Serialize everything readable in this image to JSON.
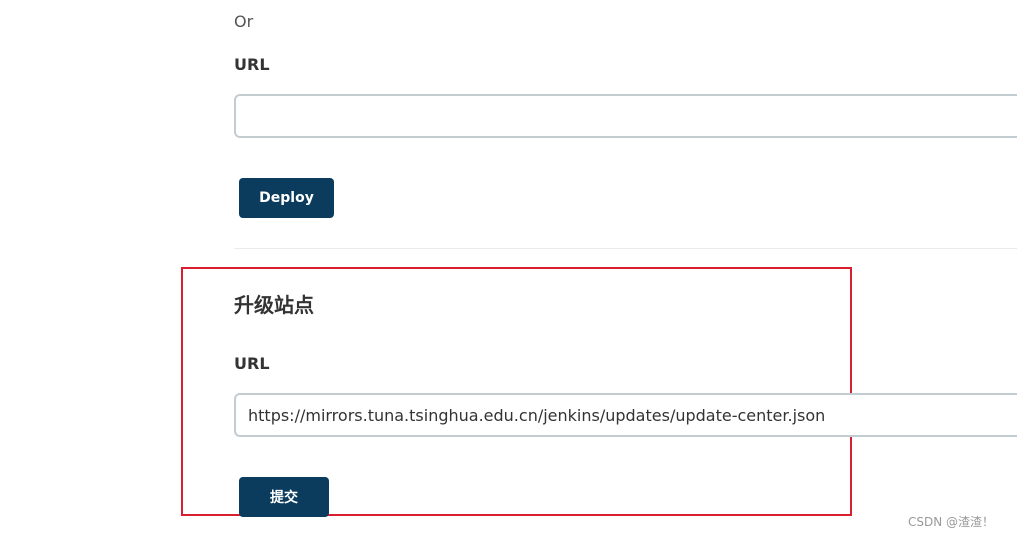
{
  "deploy_section": {
    "or_text": "Or",
    "url_label": "URL",
    "url_value": "",
    "deploy_button": "Deploy"
  },
  "update_site": {
    "heading": "升级站点",
    "url_label": "URL",
    "url_value": "https://mirrors.tuna.tsinghua.edu.cn/jenkins/updates/update-center.json",
    "submit_button": "提交"
  },
  "watermark": "CSDN @渣渣！",
  "colors": {
    "button_bg": "#0b3c5d",
    "highlight_border": "#d81e2f",
    "input_border": "#c3ccd1"
  }
}
